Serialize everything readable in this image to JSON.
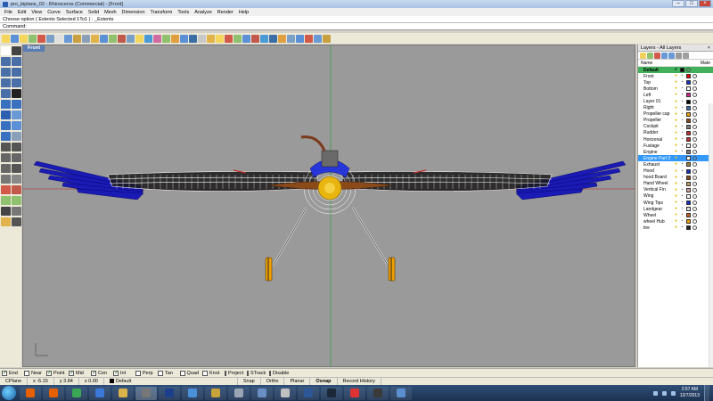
{
  "window": {
    "title": "pro_biplane_02 - Rhinoceros (Commercial) - [Front]"
  },
  "menu": [
    "File",
    "Edit",
    "View",
    "Curve",
    "Surface",
    "Solid",
    "Mesh",
    "Dimension",
    "Transform",
    "Tools",
    "Analyze",
    "Render",
    "Help"
  ],
  "command": {
    "history": "Choose option ( Extents  Selected  1To1 ) : _Extents",
    "prompt": "Command:"
  },
  "viewport": {
    "title": "Front"
  },
  "layers_panel": {
    "title": "Layers - All Layers",
    "col_name": "Name",
    "col_material": "Mate",
    "layers": [
      {
        "name": "Default",
        "color": "#000000",
        "state": "current"
      },
      {
        "name": "Front",
        "color": "#e00000"
      },
      {
        "name": "Top",
        "color": "#1030c0"
      },
      {
        "name": "Bottom",
        "color": "#ffffff"
      },
      {
        "name": "Left",
        "color": "#d02090"
      },
      {
        "name": "Layer 01",
        "color": "#000000"
      },
      {
        "name": "Right",
        "color": "#3a6ea5"
      },
      {
        "name": "Propeller cap",
        "color": "#f0a000"
      },
      {
        "name": "Propeller",
        "color": "#8a4a1a"
      },
      {
        "name": "Cockpit",
        "color": "#808080"
      },
      {
        "name": "Rudder",
        "color": "#c03030"
      },
      {
        "name": "Horizonal",
        "color": "#c03030"
      },
      {
        "name": "Fuslage",
        "color": "#ffffff"
      },
      {
        "name": "Engine",
        "color": "#808080"
      },
      {
        "name": "Engine Part 2",
        "color": "#ffffff",
        "state": "selected"
      },
      {
        "name": "Exhaust",
        "color": "#a08040"
      },
      {
        "name": "Hood",
        "color": "#1030c0"
      },
      {
        "name": "hood Board",
        "color": "#8a4a1a"
      },
      {
        "name": "Hand Wheel",
        "color": "#c0a060"
      },
      {
        "name": "Vertical Fin",
        "color": "#d0a0a0"
      },
      {
        "name": "Wing",
        "color": "#ffffff"
      },
      {
        "name": "Wing Tips",
        "color": "#1030c0"
      },
      {
        "name": "Landgear",
        "color": "#e0e0e0"
      },
      {
        "name": "Wheel",
        "color": "#c06020"
      },
      {
        "name": "wheel Hub",
        "color": "#f0a000"
      },
      {
        "name": "tire",
        "color": "#222222"
      }
    ]
  },
  "osnap": [
    {
      "label": "End",
      "checked": true
    },
    {
      "label": "Near",
      "checked": false
    },
    {
      "label": "Point",
      "checked": true
    },
    {
      "label": "Mid",
      "checked": true
    },
    {
      "label": "Cen",
      "checked": true
    },
    {
      "label": "Int",
      "checked": true
    },
    {
      "label": "Perp",
      "checked": false
    },
    {
      "label": "Tan",
      "checked": false
    },
    {
      "label": "Quad",
      "checked": false
    },
    {
      "label": "Knot",
      "checked": false
    },
    {
      "label": "Project",
      "checked": false
    },
    {
      "label": "STrack",
      "checked": false
    },
    {
      "label": "Disable",
      "checked": false
    }
  ],
  "status": {
    "cplane": "CPlane",
    "x": "x -5.15",
    "y": "y 3.84",
    "z": "z 0.00",
    "layer": "Default",
    "snap": "Snap",
    "ortho": "Ortho",
    "planar": "Planar",
    "osnap": "Osnap",
    "record_history": "Record History"
  },
  "taskbar": {
    "time": "2:57 AM",
    "date": "12/7/2013",
    "apps": [
      {
        "icon": "firefox-icon",
        "color": "#e66000"
      },
      {
        "icon": "firefox-icon",
        "color": "#e66000"
      },
      {
        "icon": "chrome-icon",
        "color": "#3aa757"
      },
      {
        "icon": "media-player-icon",
        "color": "#3c78d8"
      },
      {
        "icon": "folder-icon",
        "color": "#d9b24a"
      },
      {
        "icon": "rhino-icon",
        "color": "#777777"
      },
      {
        "icon": "photoshop-icon",
        "color": "#1c3f8c"
      },
      {
        "icon": "paint-icon",
        "color": "#4a90d9"
      },
      {
        "icon": "rhino-render-icon",
        "color": "#c7a33a"
      },
      {
        "icon": "calculator-icon",
        "color": "#9aa5b5"
      },
      {
        "icon": "scan-icon",
        "color": "#6a8fc7"
      },
      {
        "icon": "fraps-icon",
        "color": "#c0c0c0"
      },
      {
        "icon": "word-icon",
        "color": "#2b5797"
      },
      {
        "icon": "steam-icon",
        "color": "#1b2838"
      },
      {
        "icon": "record-icon",
        "color": "#d33"
      },
      {
        "icon": "game-icon",
        "color": "#3a3a3a"
      },
      {
        "icon": "network-icon",
        "color": "#5a8fd0"
      }
    ]
  }
}
